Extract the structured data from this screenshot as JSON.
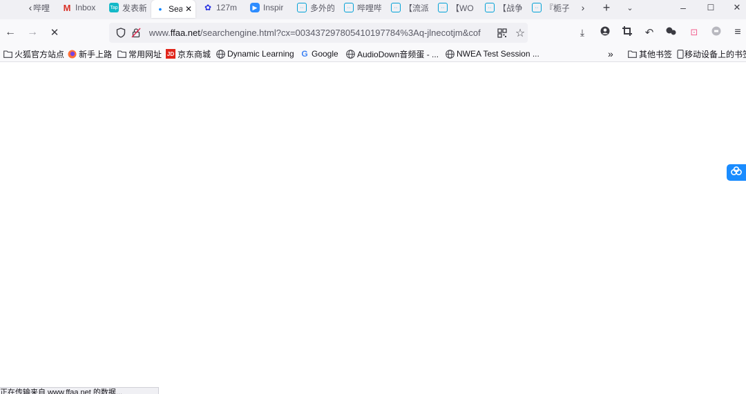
{
  "tabs": [
    {
      "label": "哔哩",
      "icon": "bilibili-icon",
      "active": false
    },
    {
      "label": "Inbox",
      "icon": "gmail-icon",
      "active": false
    },
    {
      "label": "发表新",
      "icon": "tap-icon",
      "active": false
    },
    {
      "label": "Sea",
      "icon": "dot-icon",
      "active": true
    },
    {
      "label": "127m",
      "icon": "baidu-icon",
      "active": false
    },
    {
      "label": "Inspir",
      "icon": "zoom-icon",
      "active": false
    },
    {
      "label": "多外的",
      "icon": "bilibili-icon",
      "active": false
    },
    {
      "label": "哔哩哔",
      "icon": "bilibili-icon",
      "active": false
    },
    {
      "label": "【流派",
      "icon": "bilibili-icon",
      "active": false
    },
    {
      "label": "【WO",
      "icon": "bilibili-icon",
      "active": false
    },
    {
      "label": "【战争",
      "icon": "bilibili-icon",
      "active": false
    },
    {
      "label": "『栀子",
      "icon": "bilibili-icon",
      "active": false
    }
  ],
  "url": {
    "prefix": "www.",
    "domain": "ffaa.net",
    "path": "/searchengine.html?cx=003437297805410197784%3Aq-jlnecotjm&cof"
  },
  "bookmarks": [
    {
      "label": "火狐官方站点",
      "icon": "folder-icon"
    },
    {
      "label": "新手上路",
      "icon": "firefox-icon"
    },
    {
      "label": "常用网址",
      "icon": "folder-icon"
    },
    {
      "label": "京东商城",
      "icon": "jd-icon"
    },
    {
      "label": "Dynamic Learning",
      "icon": "globe-icon"
    },
    {
      "label": "Google",
      "icon": "google-icon"
    },
    {
      "label": "AudioDown音频蛋 - ...",
      "icon": "globe-icon"
    },
    {
      "label": "NWEA Test Session ...",
      "icon": "globe-icon"
    }
  ],
  "bookmarks_right": [
    {
      "label": "其他书签",
      "icon": "folder-icon"
    },
    {
      "label": "移动设备上的书签",
      "icon": "mobile-icon"
    }
  ],
  "status": "正在传输来自 www.ffaa.net 的数据...",
  "colors": {
    "accent": "#1a8cff",
    "jd": "#e1251b",
    "bilibili": "#00a1d6"
  }
}
